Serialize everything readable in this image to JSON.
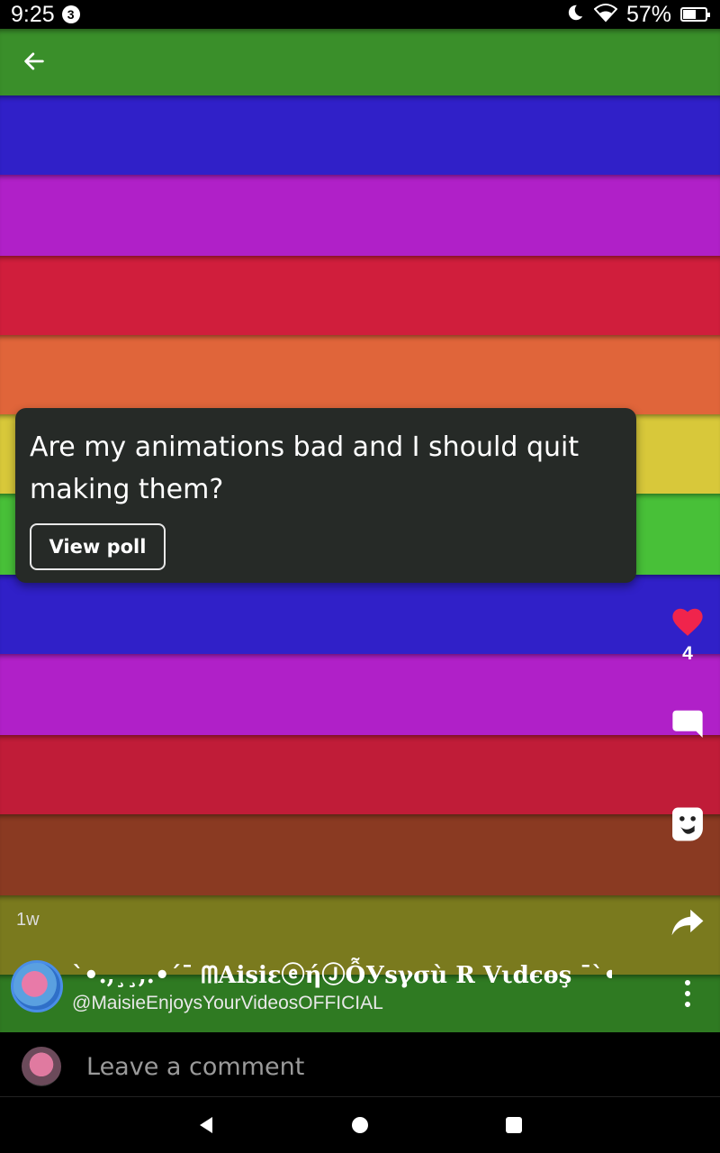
{
  "status_bar": {
    "time": "9:25",
    "notification_count": "3",
    "battery_percent": "57%",
    "battery_level": 0.57,
    "icons": [
      "moon-icon",
      "wifi-icon",
      "battery-icon"
    ]
  },
  "background": {
    "stripe_colors": [
      "#3a8f2a",
      "#3020c8",
      "#b020c8",
      "#d01e3c",
      "#e0653a",
      "#d8c83a",
      "#48c038",
      "#3020c8",
      "#b020c8",
      "#c01c38",
      "#8a3a22",
      "#7a7a1e",
      "#2f7a22"
    ]
  },
  "header": {
    "back_icon": "arrow-left-icon"
  },
  "poll": {
    "question": "Are my animations bad and I should quit making them?",
    "button_label": "View poll"
  },
  "actions": {
    "like_count": "4",
    "like_color": "#f0244c",
    "icons": [
      "heart-icon",
      "comment-icon",
      "sticker-icon",
      "share-icon"
    ]
  },
  "post": {
    "time_ago": "1w",
    "author_display_name": "`•.,¸¸,.•´¯ ᗰAisiɛⓔήⒿỖУsγσù R Vιdєѳş ¯`•.,¸¸",
    "author_handle": "@MaisieEnjoysYourVideosOFFICIAL"
  },
  "comment": {
    "placeholder": "Leave a comment"
  },
  "nav": {
    "icons": [
      "back-triangle-icon",
      "home-circle-icon",
      "recents-square-icon"
    ]
  }
}
